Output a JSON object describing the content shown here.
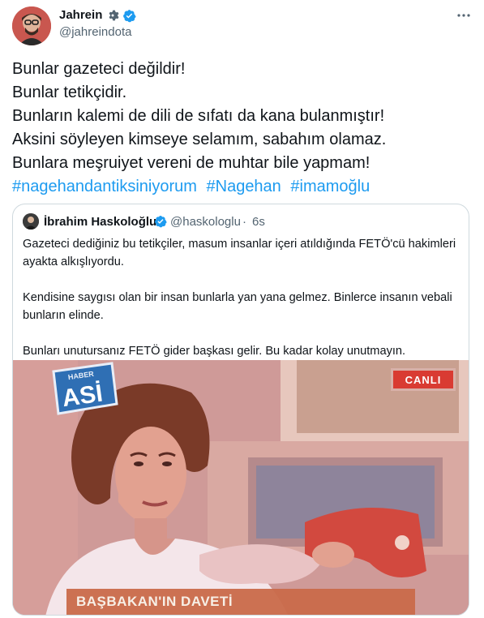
{
  "author": {
    "name": "Jahrein",
    "handle": "@jahreindota"
  },
  "tweet": {
    "lines": [
      "Bunlar gazeteci değildir!",
      "Bunlar tetikçidir.",
      "Bunların kalemi de dili de sıfatı da kana bulanmıştır!",
      "Aksini söyleyen kimseye selamım, sabahım olamaz.",
      "Bunlara meşruiyet vereni de muhtar bile yapmam!"
    ],
    "hashtags": [
      "#nagehandantiksiniyorum",
      "#Nagehan",
      "#imamoğlu"
    ]
  },
  "quote": {
    "name": "İbrahim Haskoloğlu",
    "handle": "@haskologlu",
    "separator": "·",
    "time": "6s",
    "paragraphs": [
      "Gazeteci dediğiniz bu tetikçiler, masum insanlar içeri atıldığında FETÖ'cü hakimleri ayakta alkışlıyordu.",
      "Kendisine saygısı olan bir insan bunlarla yan yana gelmez. Binlerce insanın vebali bunların elinde.",
      "Bunları unutursanız FETÖ gider başkası gelir. Bu kadar kolay unutmayın."
    ],
    "media": {
      "live_label": "CANLI",
      "badge_top": "HABER",
      "badge_main": "ASİ",
      "ticker": "BAŞBAKAN'IN DAVETİ"
    }
  },
  "colors": {
    "accent": "#1d9bf0",
    "text": "#0f1419",
    "secondary": "#536471",
    "border": "#cfd9de"
  },
  "icons": {
    "gear": "gear-icon",
    "verified": "verified-badge-icon",
    "more": "more-options-icon"
  }
}
